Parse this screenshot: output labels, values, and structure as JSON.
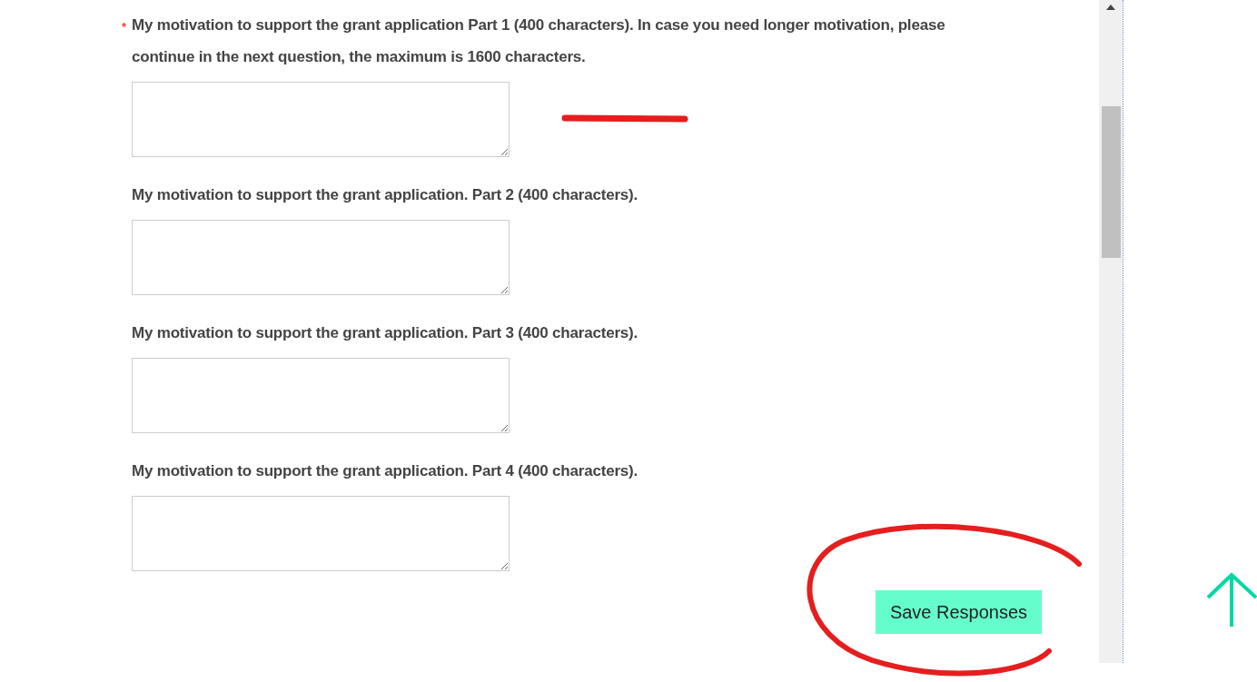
{
  "questions": [
    {
      "label": "My motivation to support the grant application Part 1 (400 characters). In case you need longer motivation, please continue in the next question, the maximum is 1600 characters.",
      "required": true
    },
    {
      "label": "My motivation to support the grant application. Part 2 (400 characters).",
      "required": false
    },
    {
      "label": "My motivation to support the grant application. Part 3 (400 characters).",
      "required": false
    },
    {
      "label": "My motivation to support the grant application. Part 4 (400 characters).",
      "required": false
    }
  ],
  "required_mark": "*",
  "save_button": "Save Responses"
}
